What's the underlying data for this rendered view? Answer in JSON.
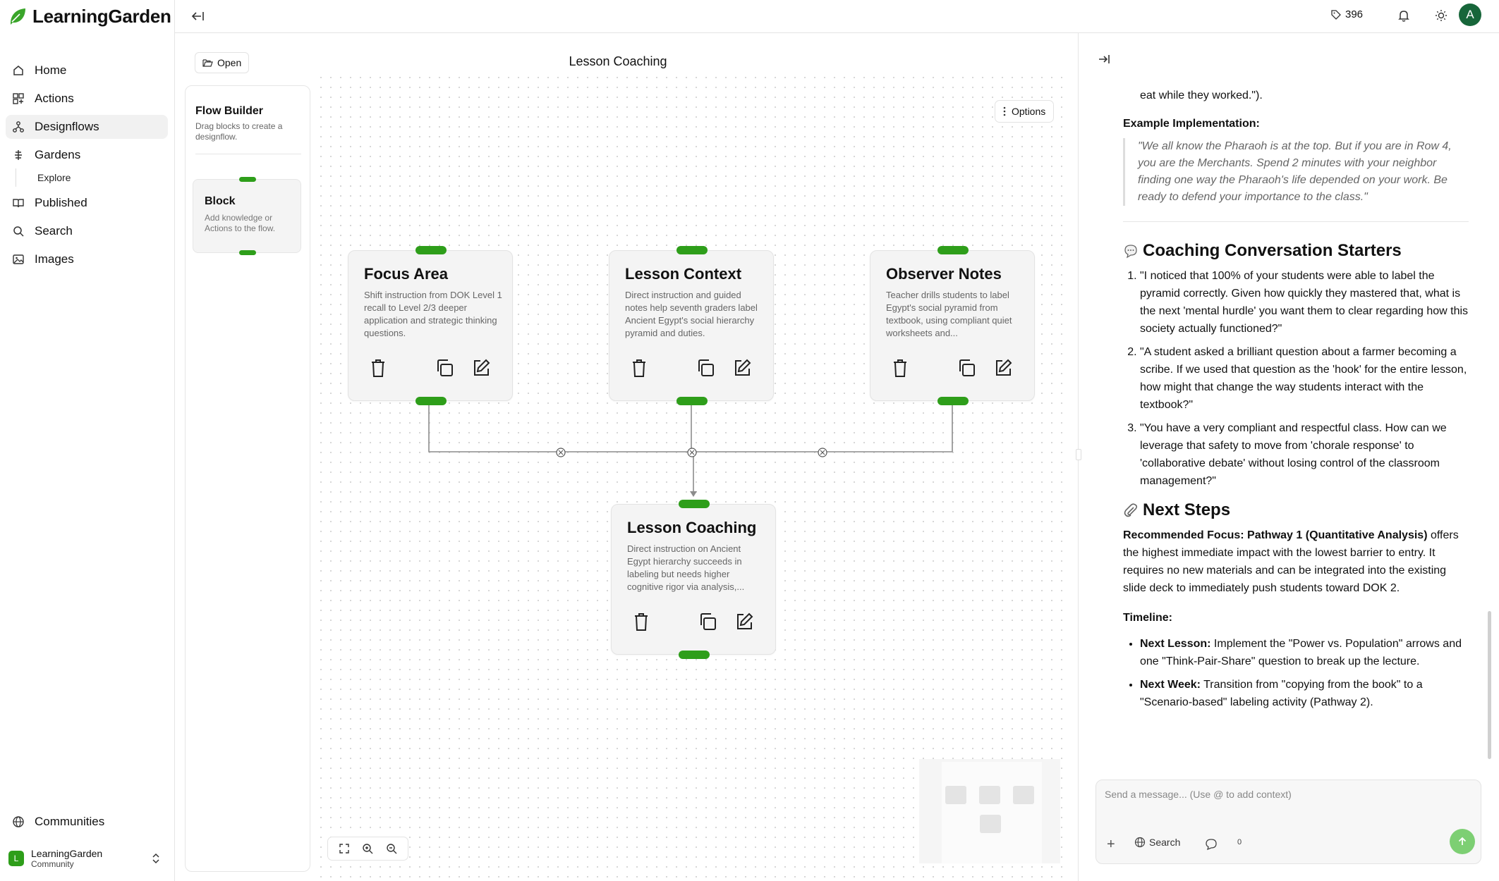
{
  "app": {
    "name": "LearningGarden"
  },
  "sidebar": {
    "items": [
      {
        "label": "Home"
      },
      {
        "label": "Actions"
      },
      {
        "label": "Designflows"
      },
      {
        "label": "Gardens"
      },
      {
        "label": "Explore"
      },
      {
        "label": "Published"
      },
      {
        "label": "Search"
      },
      {
        "label": "Images"
      }
    ],
    "communities": "Communities",
    "account": {
      "initial": "L",
      "name": "LearningGarden",
      "sub": "Community"
    }
  },
  "topbar": {
    "credits": "396",
    "avatar_initial": "A"
  },
  "canvas": {
    "open_label": "Open",
    "title": "Lesson Coaching",
    "options_label": "Options",
    "palette": {
      "title": "Flow Builder",
      "subtitle": "Drag blocks to create a designflow.",
      "block_title": "Block",
      "block_subtitle": "Add knowledge or Actions to the flow."
    },
    "nodes": [
      {
        "title": "Focus Area",
        "desc": "Shift instruction from DOK Level 1 recall to Level 2/3 deeper application and strategic thinking questions."
      },
      {
        "title": "Lesson Context",
        "desc": "Direct instruction and guided notes help seventh graders label Ancient Egypt's social hierarchy pyramid and duties."
      },
      {
        "title": "Observer Notes",
        "desc": "Teacher drills students to label Egypt's social pyramid from textbook, using compliant quiet worksheets and..."
      },
      {
        "title": "Lesson Coaching",
        "desc": "Direct instruction on Ancient Egypt hierarchy succeeds in labeling but needs higher cognitive rigor via analysis,..."
      }
    ]
  },
  "chat": {
    "top_fragment": "eat while they worked.\").",
    "example_label": "Example Implementation:",
    "example_quote": "\"We all know the Pharaoh is at the top. But if you are in Row 4, you are the Merchants. Spend 2 minutes with your neighbor finding one way the Pharaoh's life depended on your work. Be ready to defend your importance to the class.\"",
    "starters_heading": "Coaching Conversation Starters",
    "starters": [
      "\"I noticed that 100% of your students were able to label the pyramid correctly. Given how quickly they mastered that, what is the next 'mental hurdle' you want them to clear regarding how this society actually functioned?\"",
      "\"A student asked a brilliant question about a farmer becoming a scribe. If we used that question as the 'hook' for the entire lesson, how might that change the way students interact with the textbook?\"",
      "\"You have a very compliant and respectful class. How can we leverage that safety to move from 'chorale response' to 'collaborative debate' without losing control of the classroom management?\""
    ],
    "next_heading": "Next Steps",
    "focus_bold": "Recommended Focus: Pathway 1 (Quantitative Analysis)",
    "focus_rest": " offers the highest immediate impact with the lowest barrier to entry. It requires no new materials and can be integrated into the existing slide deck to immediately push students toward DOK 2.",
    "timeline_label": "Timeline:",
    "timeline": [
      {
        "label": "Next Lesson:",
        "text": " Implement the \"Power vs. Population\" arrows and one \"Think-Pair-Share\" question to break up the lecture."
      },
      {
        "label": "Next Week:",
        "text": " Transition from \"copying from the book\" to a \"Scenario-based\" labeling activity (Pathway 2)."
      }
    ]
  },
  "composer": {
    "placeholder": "Send a message... (Use @ to add context)",
    "search_label": "Search",
    "count": "0"
  },
  "colors": {
    "accent": "#2e9e1a",
    "send": "#7dcf73"
  }
}
